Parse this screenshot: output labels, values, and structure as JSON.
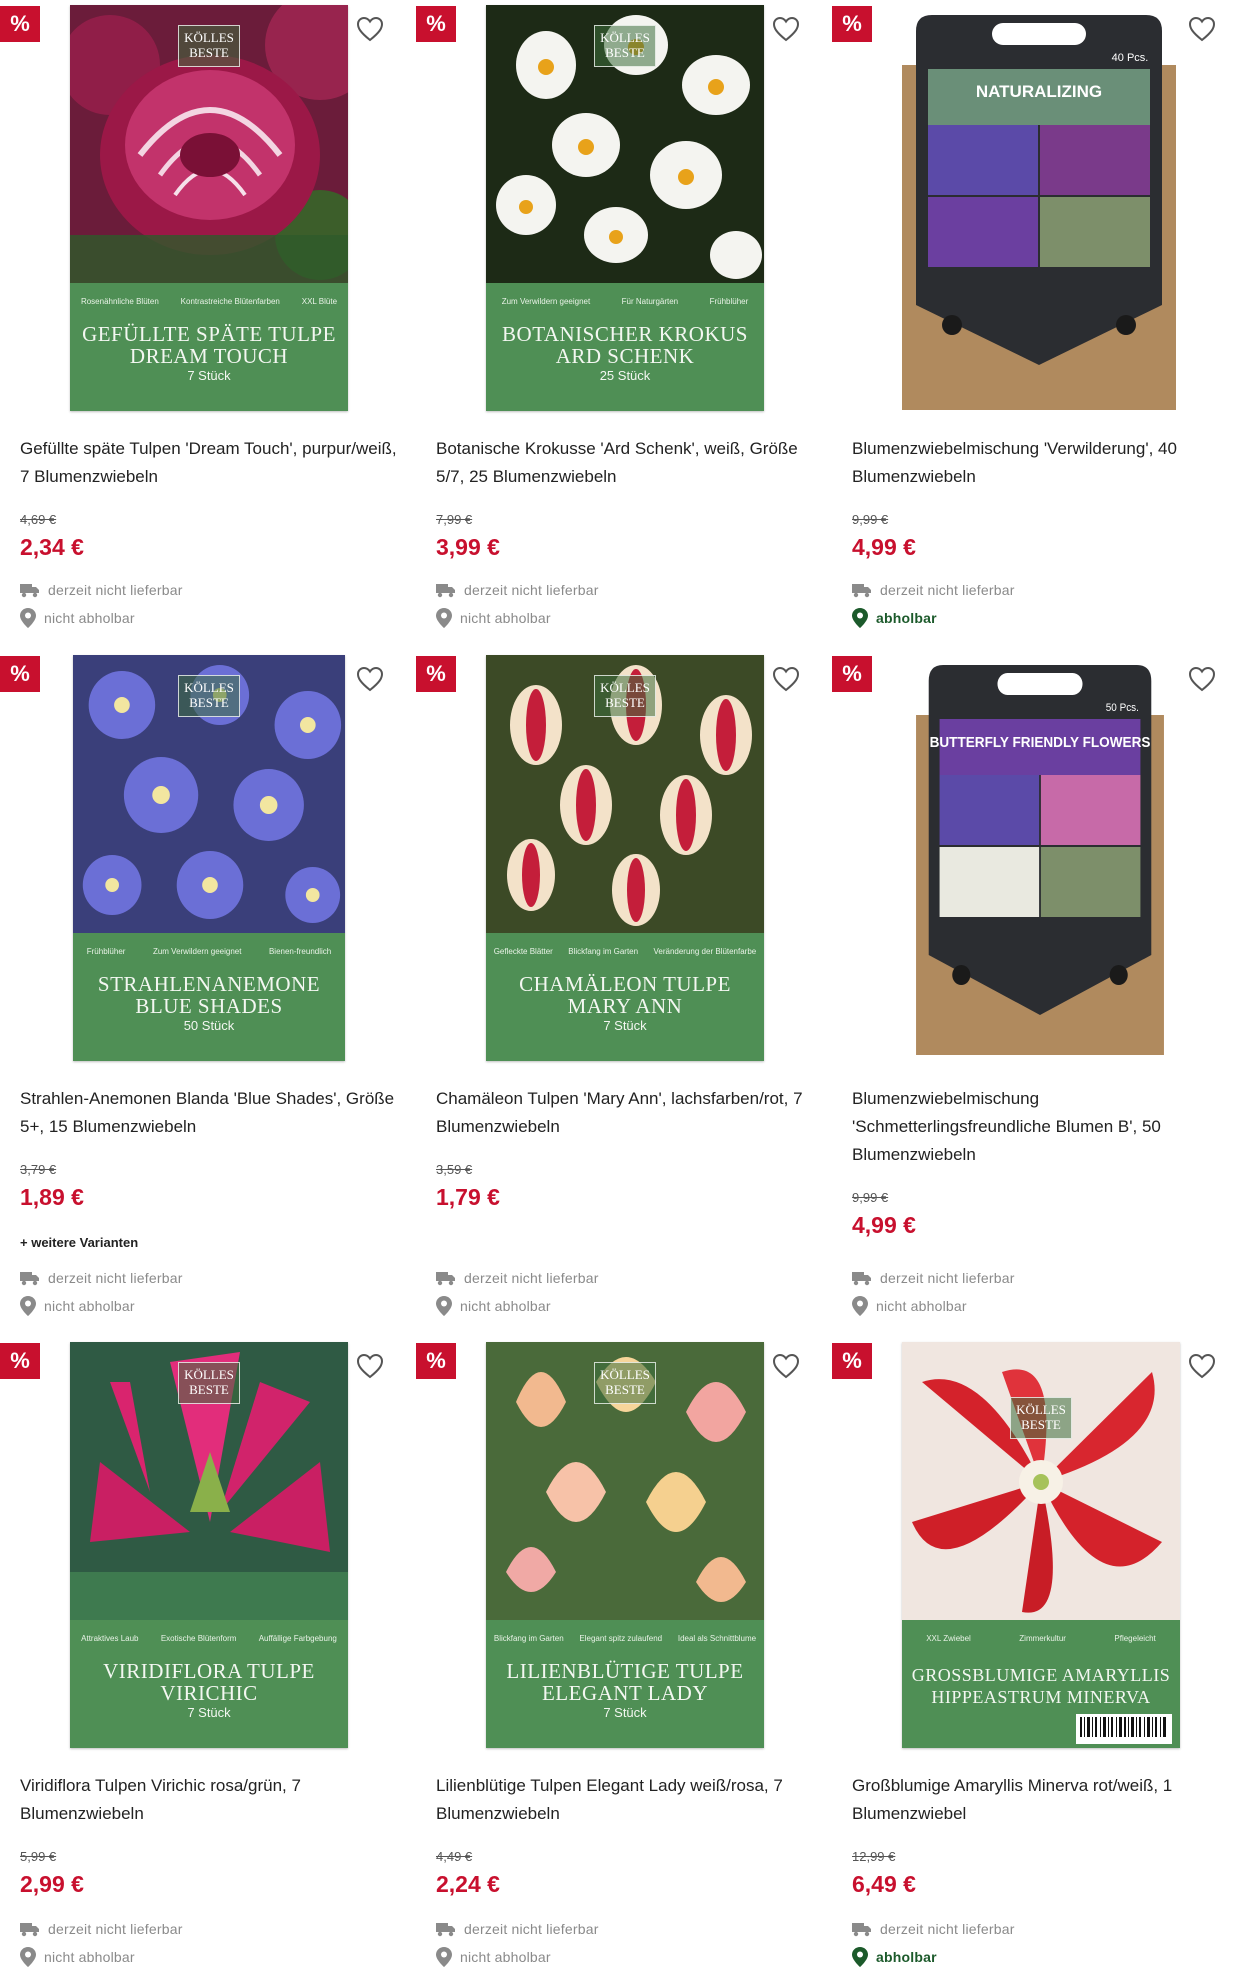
{
  "colors": {
    "accent": "#c8102e",
    "package_green": "#4f8f55",
    "available_green": "#1c5a2b",
    "muted": "#8a8a8a"
  },
  "icons": {
    "discount": "percent-badge",
    "wishlist": "heart-outline-icon",
    "delivery": "truck-icon",
    "pickup": "location-pin-icon"
  },
  "products": [
    {
      "badge": "%",
      "brand": "KÖLLES BESTE",
      "features": [
        "Rosenähnliche Blüten",
        "Kontrastreiche Blütenfarben",
        "XXL Blüte"
      ],
      "package_title": "GEFÜLLTE SPÄTE TULPE DREAM TOUCH",
      "package_count": "7 Stück",
      "name": "Gefüllte späte Tulpen 'Dream Touch', purpur/weiß, 7 Blumenzwiebeln",
      "old_price": "4,69 €",
      "price": "2,34 €",
      "delivery": "derzeit nicht lieferbar",
      "pickup": "nicht abholbar",
      "pickup_available": false
    },
    {
      "badge": "%",
      "brand": "KÖLLES BESTE",
      "features": [
        "Zum Verwildern geeignet",
        "Für Naturgärten",
        "Frühblüher"
      ],
      "package_title": "BOTANISCHER KROKUS ARD SCHENK",
      "package_count": "25 Stück",
      "name": "Botanische Krokusse 'Ard Schenk', weiß, Größe 5/7, 25 Blumenzwiebeln",
      "old_price": "7,99 €",
      "price": "3,99 €",
      "delivery": "derzeit nicht lieferbar",
      "pickup": "nicht abholbar",
      "pickup_available": false
    },
    {
      "badge": "%",
      "bag_title": "NATURALIZING",
      "bag_count": "40 Pcs.",
      "name": "Blumenzwiebelmischung 'Verwilderung', 40 Blumenzwiebeln",
      "old_price": "9,99 €",
      "price": "4,99 €",
      "delivery": "derzeit nicht lieferbar",
      "pickup": "abholbar",
      "pickup_available": true
    },
    {
      "badge": "%",
      "brand": "KÖLLES BESTE",
      "features": [
        "Frühblüher",
        "Zum Verwildern geeignet",
        "Bienen-freundlich"
      ],
      "package_title": "STRAHLENANEMONE BLUE SHADES",
      "package_count": "50 Stück",
      "name": "Strahlen-Anemonen Blanda 'Blue Shades', Größe 5+, 15 Blumenzwiebeln",
      "old_price": "3,79 €",
      "price": "1,89 €",
      "variants": "+ weitere Varianten",
      "delivery": "derzeit nicht lieferbar",
      "pickup": "nicht abholbar",
      "pickup_available": false
    },
    {
      "badge": "%",
      "brand": "KÖLLES BESTE",
      "features": [
        "Gefleckte Blätter",
        "Blickfang im Garten",
        "Veränderung der Blütenfarbe"
      ],
      "package_title": "CHAMÄLEON TULPE MARY ANN",
      "package_count": "7 Stück",
      "name": "Chamäleon Tulpen 'Mary Ann', lachsfarben/rot, 7 Blumenzwiebeln",
      "old_price": "3,59 €",
      "price": "1,79 €",
      "delivery": "derzeit nicht lieferbar",
      "pickup": "nicht abholbar",
      "pickup_available": false
    },
    {
      "badge": "%",
      "bag_title": "BUTTERFLY FRIENDLY FLOWERS",
      "bag_count": "50 Pcs.",
      "name": "Blumenzwiebelmischung 'Schmetterlingsfreundliche Blumen B', 50 Blumenzwiebeln",
      "old_price": "9,99 €",
      "price": "4,99 €",
      "delivery": "derzeit nicht lieferbar",
      "pickup": "nicht abholbar",
      "pickup_available": false
    },
    {
      "badge": "%",
      "brand": "KÖLLES BESTE",
      "features": [
        "Attraktives Laub",
        "Exotische Blütenform",
        "Auffällige Farbgebung"
      ],
      "package_title": "VIRIDIFLORA TULPE VIRICHIC",
      "package_count": "7 Stück",
      "name": "Viridiflora Tulpen Virichic rosa/grün, 7 Blumenzwiebeln",
      "old_price": "5,99 €",
      "price": "2,99 €",
      "delivery": "derzeit nicht lieferbar",
      "pickup": "nicht abholbar",
      "pickup_available": false
    },
    {
      "badge": "%",
      "brand": "KÖLLES BESTE",
      "features": [
        "Blickfang im Garten",
        "Elegant spitz zulaufend",
        "Ideal als Schnittblume"
      ],
      "package_title": "LILIENBLÜTIGE TULPE ELEGANT LADY",
      "package_count": "7 Stück",
      "name": "Lilienblütige Tulpen Elegant Lady weiß/rosa, 7 Blumenzwiebeln",
      "old_price": "4,49 €",
      "price": "2,24 €",
      "delivery": "derzeit nicht lieferbar",
      "pickup": "nicht abholbar",
      "pickup_available": false
    },
    {
      "badge": "%",
      "brand": "KÖLLES BESTE",
      "features": [
        "XXL Zwiebel",
        "Zimmerkultur",
        "Pflegeleicht"
      ],
      "package_title": "GROSSBLUMIGE AMARYLLIS HIPPEASTRUM MINERVA",
      "package_count": "",
      "name": "Großblumige Amaryllis Minerva rot/weiß, 1 Blumenzwiebel",
      "old_price": "12,99 €",
      "price": "6,49 €",
      "delivery": "derzeit nicht lieferbar",
      "pickup": "abholbar",
      "pickup_available": true
    }
  ]
}
